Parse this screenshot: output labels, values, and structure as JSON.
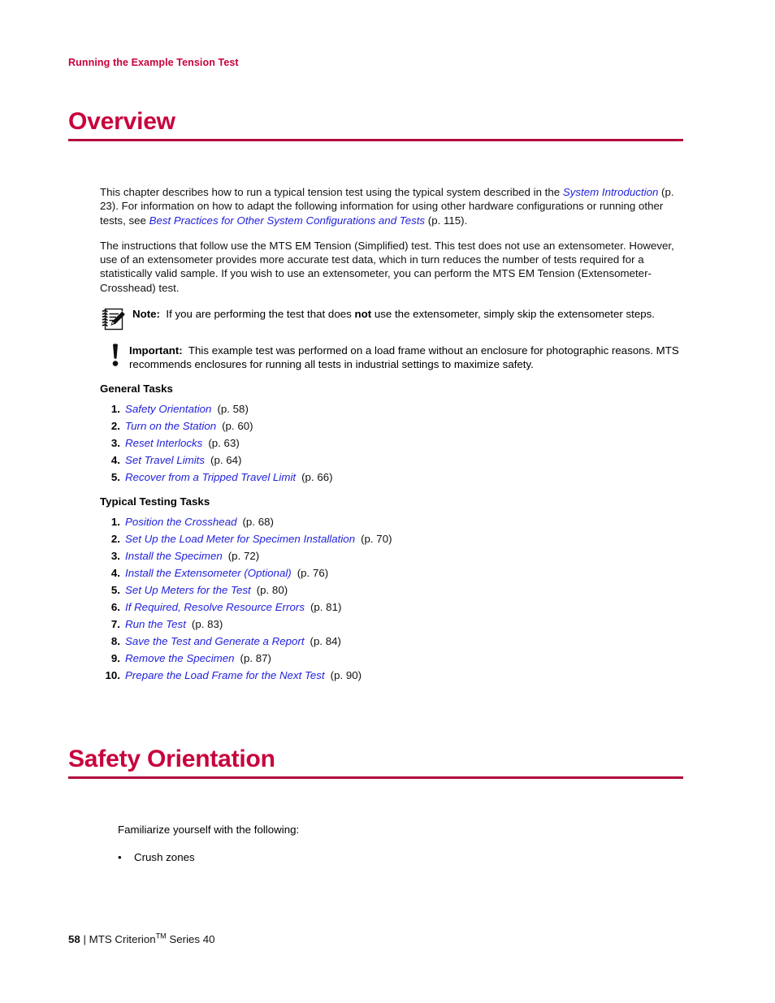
{
  "running_head": "Running the Example Tension Test",
  "sections": {
    "overview": {
      "title": "Overview",
      "paragraphs": {
        "p1": {
          "t1": "This chapter describes how to run a typical tension test using the typical system described in the ",
          "link1": "System Introduction",
          "t2": " (p. 23). For information on how to adapt the following information for using other hardware configurations or running other tests, see ",
          "link2": "Best Practices for Other System Configurations and Tests",
          "t3": " (p. 115)."
        },
        "p2": "The instructions that follow use the MTS EM Tension (Simplified) test. This test does not use an extensometer. However, use of an extensometer provides more accurate test data, which in turn reduces the number of tests required for a statistically valid sample. If you wish to use an extensometer, you can perform the MTS EM Tension (Extensometer-Crosshead) test."
      },
      "note": {
        "label": "Note:",
        "t1": "If you are performing the test that does ",
        "emphasis": "not",
        "t2": " use the extensometer, simply skip the extensometer steps.",
        "icon": "note-pad-pencil-icon"
      },
      "important": {
        "label": "Important:",
        "text": "This example test was performed on a load frame without an enclosure for photographic reasons. MTS recommends enclosures for running all tests in industrial settings to maximize safety.",
        "icon": "exclamation-icon"
      },
      "general_tasks": {
        "heading": "General Tasks",
        "items": [
          {
            "num": "1.",
            "label": "Safety Orientation",
            "pageref": "(p. 58)"
          },
          {
            "num": "2.",
            "label": "Turn on the Station",
            "pageref": "(p. 60)"
          },
          {
            "num": "3.",
            "label": "Reset Interlocks",
            "pageref": "(p. 63)"
          },
          {
            "num": "4.",
            "label": "Set Travel Limits",
            "pageref": "(p. 64)"
          },
          {
            "num": "5.",
            "label": "Recover from a Tripped Travel Limit",
            "pageref": "(p. 66)"
          }
        ]
      },
      "typical_testing_tasks": {
        "heading": "Typical Testing Tasks",
        "items": [
          {
            "num": "1.",
            "label": "Position the Crosshead",
            "pageref": "(p. 68)"
          },
          {
            "num": "2.",
            "label": "Set Up the Load Meter for Specimen Installation",
            "pageref": "(p. 70)"
          },
          {
            "num": "3.",
            "label": "Install the Specimen",
            "pageref": "(p. 72)"
          },
          {
            "num": "4.",
            "label": "Install the Extensometer (Optional)",
            "pageref": "(p. 76)"
          },
          {
            "num": "5.",
            "label": "Set Up Meters for the Test",
            "pageref": "(p. 80)"
          },
          {
            "num": "6.",
            "label": "If Required, Resolve Resource Errors",
            "pageref": "(p. 81)"
          },
          {
            "num": "7.",
            "label": "Run the Test",
            "pageref": "(p. 83)"
          },
          {
            "num": "8.",
            "label": "Save the Test and Generate a Report",
            "pageref": "(p. 84)"
          },
          {
            "num": "9.",
            "label": "Remove the Specimen",
            "pageref": "(p. 87)"
          },
          {
            "num": "10.",
            "label": "Prepare the Load Frame for the Next Test",
            "pageref": "(p. 90)"
          }
        ]
      }
    },
    "safety_orientation": {
      "title": "Safety Orientation",
      "lead": "Familiarize yourself with the following:",
      "bullets": [
        {
          "marker": "•",
          "label": "Crush zones"
        }
      ]
    }
  },
  "footer": {
    "page_number": "58",
    "separator": "|",
    "product_pre": "MTS Criterion",
    "trademark": "TM",
    "product_post": " Series 40"
  },
  "colors": {
    "heading_red": "#C8023C",
    "rule_red": "#B30A3C",
    "link_blue": "#2222DD",
    "body_black": "#111111",
    "page_background": "#FFFFFF"
  }
}
